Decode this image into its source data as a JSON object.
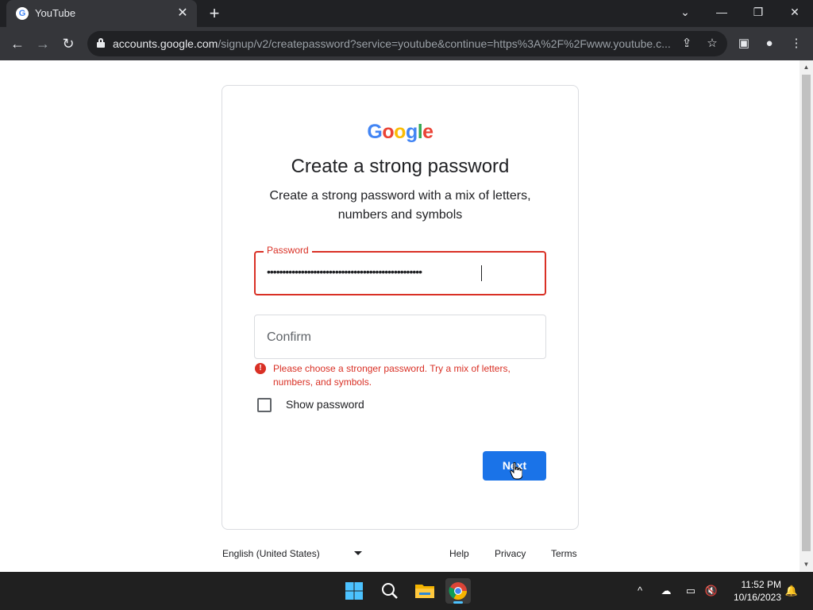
{
  "browser": {
    "tab_title": "YouTube",
    "favicon_letter": "G",
    "url_host": "accounts.google.com",
    "url_path": "/signup/v2/createpassword?service=youtube&continue=https%3A%2F%2Fwww.youtube.c..."
  },
  "card": {
    "logo": "Google",
    "logo_colors": [
      "#4285F4",
      "#EA4335",
      "#FBBC05",
      "#4285F4",
      "#34A853",
      "#EA4335"
    ],
    "heading": "Create a strong password",
    "subtext": "Create a strong password with a mix of letters, numbers and symbols",
    "password_label": "Password",
    "password_value": "••••••••••••••••••••••••••••••••••••••••••••••••••",
    "confirm_placeholder": "Confirm",
    "error_text": "Please choose a stronger password. Try a mix of letters, numbers, and symbols.",
    "show_password_label": "Show password",
    "show_password_checked": false,
    "next_label": "Next"
  },
  "footer": {
    "language": "English (United States)",
    "links": [
      "Help",
      "Privacy",
      "Terms"
    ]
  },
  "taskbar": {
    "time": "11:52 PM",
    "date": "10/16/2023",
    "apps": [
      "start-icon",
      "search-icon",
      "file-explorer-icon",
      "chrome-icon"
    ]
  },
  "colors": {
    "accent": "#1a73e8",
    "error": "#d93025"
  }
}
